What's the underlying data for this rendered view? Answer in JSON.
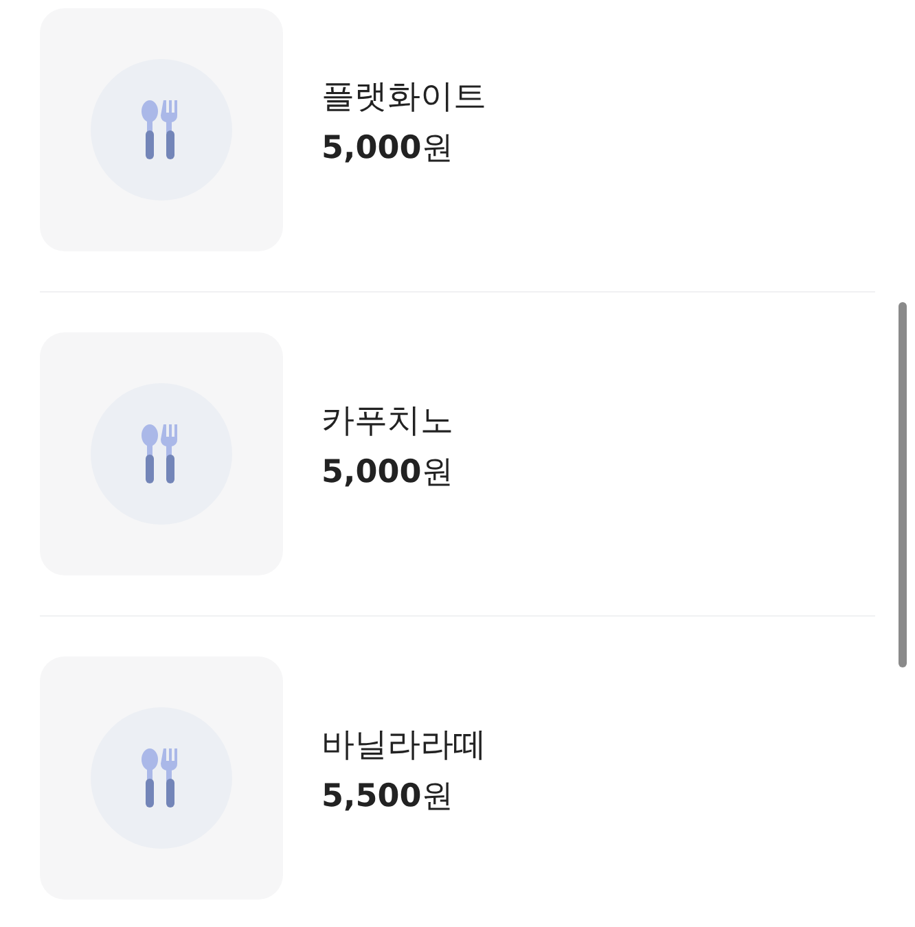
{
  "menu_items": [
    {
      "name": "플랫화이트",
      "price": "**5,000**원"
    },
    {
      "name": "카푸치노",
      "price": "**5,000**원"
    },
    {
      "name": "바닐라라떼",
      "price": "**5,500**원"
    }
  ]
}
